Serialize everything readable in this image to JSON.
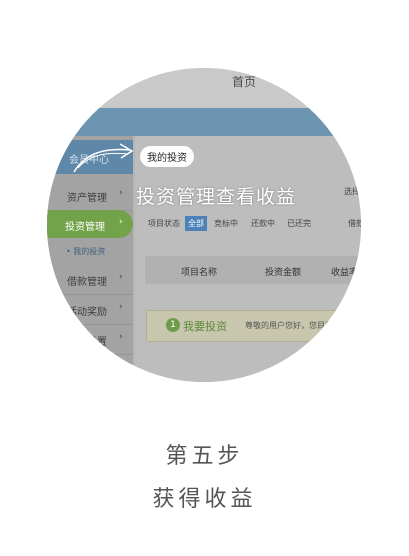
{
  "header": {
    "home": "首页"
  },
  "sidebar": {
    "member_center": "会员中心",
    "items": [
      {
        "label": "资产管理",
        "arrow": "›"
      },
      {
        "label": "投资管理",
        "arrow": "›"
      },
      {
        "label": "借款管理",
        "arrow": "›"
      },
      {
        "label": "活动奖励",
        "arrow": "›"
      },
      {
        "label": "账户设置",
        "arrow": "›"
      }
    ],
    "sub_item": "• 我的投资"
  },
  "main": {
    "bubble": "我的投资",
    "overlay": "投资管理查看收益",
    "select_hint": "选择",
    "filter_label": "项目状态",
    "filters": [
      "全部",
      "竞标中",
      "还款中",
      "已还完"
    ],
    "right_filter": "借款",
    "columns": [
      "项目名称",
      "投资金额",
      "收益率"
    ],
    "notice": {
      "num": "1",
      "title": "我要投资",
      "desc": "尊敬的用户您好，您目前"
    }
  },
  "caption": {
    "step": "第五步",
    "text": "获得收益"
  },
  "colors": {
    "accent_green": "#72a34a",
    "accent_blue": "#5f8fb0"
  }
}
